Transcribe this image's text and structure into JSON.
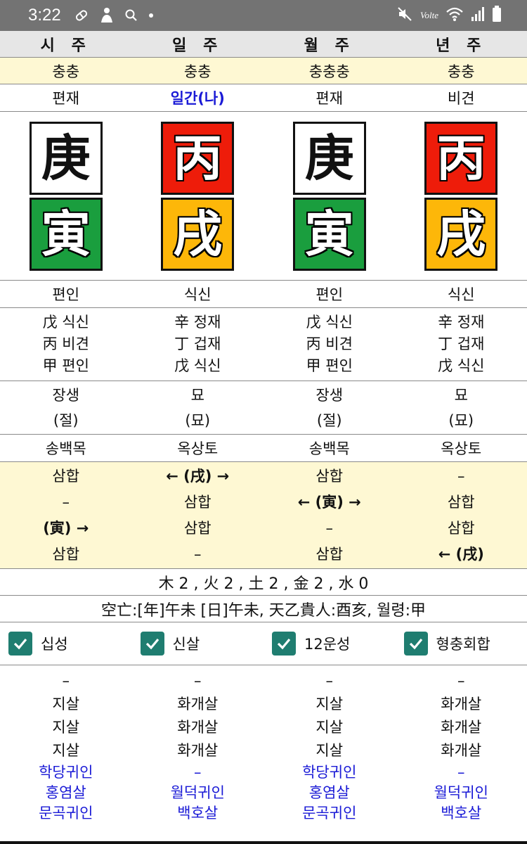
{
  "status_bar": {
    "time": "3:22",
    "left_icons": [
      "pill-icon",
      "gesture-icon",
      "search-icon",
      "dot-icon"
    ],
    "right_icons": [
      "mute-icon",
      "volte-icon",
      "wifi-icon",
      "signal-icon",
      "battery-icon"
    ],
    "volte_label": "Volte"
  },
  "columns": [
    {
      "header": "시 주",
      "chung": "충충",
      "sipsung": "편재",
      "stem": {
        "char": "庚",
        "color": "#ffffff",
        "text_style": "light"
      },
      "branch": {
        "char": "寅",
        "color": "#1a9e3e",
        "text_style": "dark"
      },
      "jiji_sipsung": "편인",
      "hidden": [
        "戊 식신",
        "丙 비견",
        "甲 편인"
      ],
      "unseong": "장생",
      "unseong_sub": "(절)",
      "nabeum": "송백목",
      "hap": [
        {
          "text": "삼합",
          "bold": false
        },
        {
          "text": "–",
          "bold": false
        },
        {
          "text": "(寅) →",
          "bold": true
        },
        {
          "text": "삼합",
          "bold": false
        }
      ],
      "sinsal_black": [
        "–",
        "지살",
        "지살",
        "지살"
      ],
      "sinsal_blue": [
        "학당귀인",
        "홍염살",
        "문곡귀인"
      ]
    },
    {
      "header": "일 주",
      "chung": "충충",
      "sipsung": "일간(나)",
      "sipsung_highlight": true,
      "stem": {
        "char": "丙",
        "color": "#ee1c0a",
        "text_style": "dark"
      },
      "branch": {
        "char": "戌",
        "color": "#fdb709",
        "text_style": "dark"
      },
      "jiji_sipsung": "식신",
      "hidden": [
        "辛 정재",
        "丁 겁재",
        "戊 식신"
      ],
      "unseong": "묘",
      "unseong_sub": "(묘)",
      "nabeum": "옥상토",
      "hap": [
        {
          "text": "← (戌) →",
          "bold": true
        },
        {
          "text": "삼합",
          "bold": false
        },
        {
          "text": "삼합",
          "bold": false
        },
        {
          "text": "–",
          "bold": false
        }
      ],
      "sinsal_black": [
        "–",
        "화개살",
        "화개살",
        "화개살"
      ],
      "sinsal_blue": [
        "–",
        "월덕귀인",
        "백호살"
      ]
    },
    {
      "header": "월 주",
      "chung": "충충충",
      "sipsung": "편재",
      "stem": {
        "char": "庚",
        "color": "#ffffff",
        "text_style": "light"
      },
      "branch": {
        "char": "寅",
        "color": "#1a9e3e",
        "text_style": "dark"
      },
      "jiji_sipsung": "편인",
      "hidden": [
        "戊 식신",
        "丙 비견",
        "甲 편인"
      ],
      "unseong": "장생",
      "unseong_sub": "(절)",
      "nabeum": "송백목",
      "hap": [
        {
          "text": "삼합",
          "bold": false
        },
        {
          "text": "← (寅) →",
          "bold": true
        },
        {
          "text": "–",
          "bold": false
        },
        {
          "text": "삼합",
          "bold": false
        }
      ],
      "sinsal_black": [
        "–",
        "지살",
        "지살",
        "지살"
      ],
      "sinsal_blue": [
        "학당귀인",
        "홍염살",
        "문곡귀인"
      ]
    },
    {
      "header": "년 주",
      "chung": "충충",
      "sipsung": "비견",
      "stem": {
        "char": "丙",
        "color": "#ee1c0a",
        "text_style": "dark"
      },
      "branch": {
        "char": "戌",
        "color": "#fdb709",
        "text_style": "dark"
      },
      "jiji_sipsung": "식신",
      "hidden": [
        "辛 정재",
        "丁 겁재",
        "戊 식신"
      ],
      "unseong": "묘",
      "unseong_sub": "(묘)",
      "nabeum": "옥상토",
      "hap": [
        {
          "text": "–",
          "bold": false
        },
        {
          "text": "삼합",
          "bold": false
        },
        {
          "text": "삼합",
          "bold": false
        },
        {
          "text": "← (戌)",
          "bold": true
        }
      ],
      "sinsal_black": [
        "–",
        "화개살",
        "화개살",
        "화개살"
      ],
      "sinsal_blue": [
        "–",
        "월덕귀인",
        "백호살"
      ]
    }
  ],
  "ohaeng": "木 2 , 火 2 , 土 2 , 金 2 , 水 0",
  "gongmang": "空亡:[年]午未 [日]午未, 天乙貴人:酉亥, 월령:甲",
  "checkboxes": [
    {
      "label": "십성",
      "checked": true
    },
    {
      "label": "신살",
      "checked": true
    },
    {
      "label": "12운성",
      "checked": true
    },
    {
      "label": "형충회합",
      "checked": true
    }
  ],
  "colors": {
    "header_bg": "#e6e6e6",
    "yellow_bg": "#fef8d3",
    "blue_text": "#1a1ad6",
    "checkbox": "#1f7d70"
  }
}
